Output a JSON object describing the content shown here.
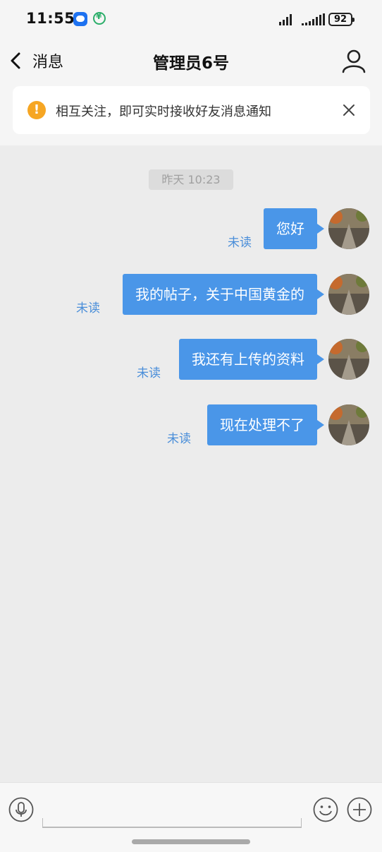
{
  "status_bar": {
    "time": "11:55",
    "battery": "92"
  },
  "header": {
    "back_label": "消息",
    "title": "管理员6号"
  },
  "banner": {
    "text": "相互关注，即可实时接收好友消息通知",
    "warn_glyph": "!"
  },
  "chat": {
    "timestamp": "昨天 10:23",
    "messages": [
      {
        "text": "您好",
        "status": "未读"
      },
      {
        "text": "我的帖子，关于中国黄金的",
        "status": "未读"
      },
      {
        "text": "我还有上传的资料",
        "status": "未读"
      },
      {
        "text": "现在处理不了",
        "status": "未读"
      }
    ]
  },
  "colors": {
    "bubble": "#4a96e8",
    "unread": "#4a8ed9",
    "warning": "#f6a623",
    "background": "#ececec"
  },
  "icons": [
    "back-icon",
    "profile-icon",
    "warning-icon",
    "close-icon",
    "voice-icon",
    "emoji-icon",
    "plus-icon"
  ]
}
